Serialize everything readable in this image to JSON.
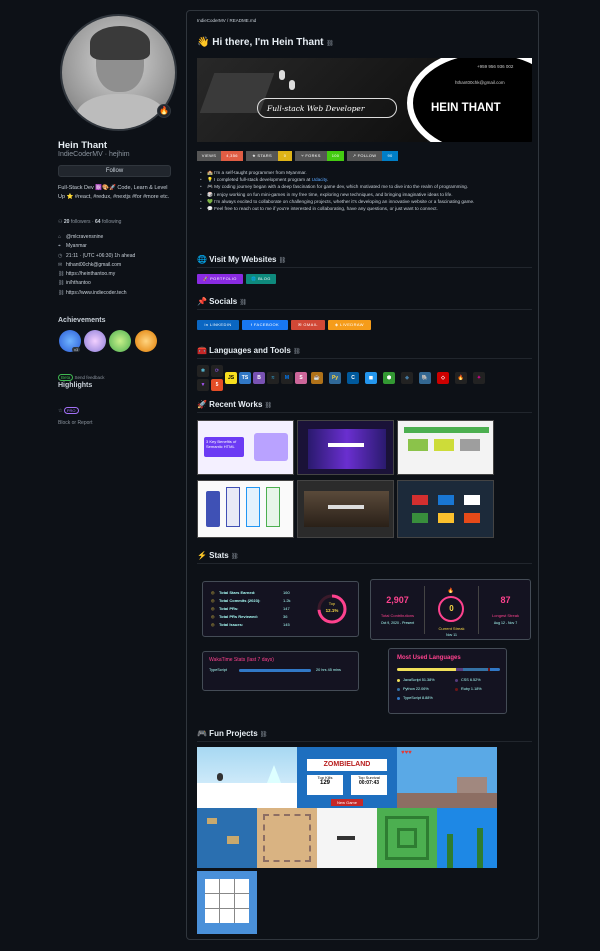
{
  "profile": {
    "name": "Hein Thant",
    "username": "IndieCoderMV · hejhim",
    "follow_label": "Follow",
    "bio": "Full-Stack Dev ⚛️🎨🚀 Code, Learn & Level Up ⭐ #react, #redux, #nextjs #for #more etc.",
    "followers_count": "20",
    "followers_label": "followers",
    "following_count": "64",
    "following_label": "following",
    "meta": [
      {
        "icon": "org-icon",
        "glyph": "⌂",
        "text": "@mlcravensnine"
      },
      {
        "icon": "location-icon",
        "glyph": "⌖",
        "text": "Myanmar"
      },
      {
        "icon": "clock-icon",
        "glyph": "◷",
        "text": "21:11 · (UTC +06:30) 1h ahead"
      },
      {
        "icon": "mail-icon",
        "glyph": "✉",
        "text": "hthant00chk@gmail.com"
      },
      {
        "icon": "link-icon",
        "glyph": "⛓",
        "text": "https://heinthantoo.my"
      },
      {
        "icon": "link-icon",
        "glyph": "⛓",
        "text": "in/hthantoo"
      },
      {
        "icon": "link-icon",
        "glyph": "⛓",
        "text": "https://www.indiecoder.tech"
      }
    ],
    "achievements_title": "Achievements",
    "achievement_x3": "x3",
    "beta_label": "Beta",
    "send_feedback": "Send feedback",
    "highlights_title": "Highlights",
    "pro_label": "PRO",
    "block_report": "Block or Report"
  },
  "readme": {
    "path": "IndieCoderMV / README.md",
    "greeting": "👋 Hi there, I'm Hein Thant",
    "banner": {
      "tagline": "Full-stack Web Developer",
      "phone": "+959 956 936 002",
      "email": "hthant00chk@gmail.com",
      "title": "HEIN THANT"
    },
    "shields": [
      {
        "label": "VIEWS",
        "value": "4,356",
        "lc": "#555",
        "vc": "#e05d44"
      },
      {
        "label": "★ STARS",
        "value": "0",
        "lc": "#555",
        "vc": "#dfb317"
      },
      {
        "label": "⑂ FORKS",
        "value": "100",
        "lc": "#555",
        "vc": "#4c1"
      },
      {
        "label": "↗ FOLLOW",
        "value": "90",
        "lc": "#555",
        "vc": "#007ec6"
      }
    ],
    "intro": [
      "🏫 I'm a self-taught programmer from Myanmar.",
      "💡 I completed full-stack development program at Udacity.",
      "🎮 My coding journey began with a deep fascination for game dev, which motivated me to dive into the realm of programming.",
      "🎲 I enjoy working on fun mini-games in my free time, exploring new techniques, and bringing imaginative ideas to life.",
      "💚 I'm always excited to collaborate on challenging projects, whether it's developing an innovative website or a fascinating game.",
      "💬 Feel free to reach out to me if you're interested in collaborating, have any questions, or just want to connect."
    ],
    "intro_link": "Udacity",
    "websites_title": "🌐 Visit My Websites",
    "websites": [
      {
        "label": "🚀 PORTFOLIO",
        "color": "#8a2be2"
      },
      {
        "label": "🌐 BLOG",
        "color": "#0e8a7d"
      }
    ],
    "socials_title": "📌 Socials",
    "socials": [
      {
        "label": "in LINKEDIN",
        "color": "#0a66c2"
      },
      {
        "label": "f FACEBOOK",
        "color": "#1877f2"
      },
      {
        "label": "✉ GMAIL",
        "color": "#d14836"
      },
      {
        "label": "◈ LIVEDRAW",
        "color": "#f59c1a"
      }
    ],
    "tools_title": "🧰 Languages and Tools",
    "tools": [
      {
        "name": "react",
        "glyph": "⚛",
        "bg": "#222",
        "fg": "#61dafb"
      },
      {
        "name": "redux",
        "glyph": "⟳",
        "bg": "#222",
        "fg": "#764abc"
      },
      {
        "name": "vite",
        "glyph": "▼",
        "bg": "#222",
        "fg": "#a855f7"
      },
      {
        "name": "html",
        "glyph": "5",
        "bg": "#e44d26",
        "fg": "#fff"
      },
      {
        "name": "js",
        "glyph": "JS",
        "bg": "#f7df1e",
        "fg": "#000"
      },
      {
        "name": "ts",
        "glyph": "TS",
        "bg": "#3178c6",
        "fg": "#fff"
      },
      {
        "name": "bootstrap",
        "glyph": "B",
        "bg": "#7952b3",
        "fg": "#fff"
      },
      {
        "name": "tailwind",
        "glyph": "≈",
        "bg": "#222",
        "fg": "#38bdf8"
      },
      {
        "name": "mui",
        "glyph": "M",
        "bg": "#222",
        "fg": "#007fff"
      },
      {
        "name": "sass",
        "glyph": "S",
        "bg": "#cc6699",
        "fg": "#fff"
      },
      {
        "name": "java",
        "glyph": "☕",
        "bg": "#b07219",
        "fg": "#fff"
      },
      {
        "name": "python",
        "glyph": "Py",
        "bg": "#306998",
        "fg": "#ffd43b"
      },
      {
        "name": "c",
        "glyph": "C",
        "bg": "#00599c",
        "fg": "#fff"
      },
      {
        "name": "docker",
        "glyph": "◼",
        "bg": "#2496ed",
        "fg": "#fff"
      },
      {
        "name": "node",
        "glyph": "⬢",
        "bg": "#339933",
        "fg": "#fff"
      },
      {
        "name": "mysql",
        "glyph": "◆",
        "bg": "#222",
        "fg": "#4479a1"
      },
      {
        "name": "postgres",
        "glyph": "🐘",
        "bg": "#336791",
        "fg": "#fff"
      },
      {
        "name": "rails",
        "glyph": "◇",
        "bg": "#cc0000",
        "fg": "#fff"
      },
      {
        "name": "firebase",
        "glyph": "🔥",
        "bg": "#222",
        "fg": "#ffca28"
      },
      {
        "name": "graphql",
        "glyph": "✦",
        "bg": "#222",
        "fg": "#e10098"
      }
    ],
    "works_title": "🚀 Recent Works",
    "works_caption": "3 Key Benefits of Semantic HTML",
    "stats_title": "⚡ Stats",
    "github_stats": [
      {
        "label": "Total Stars Earned:",
        "value": "160"
      },
      {
        "label": "Total Commits (2023):",
        "value": "1.2k"
      },
      {
        "label": "Total PRs:",
        "value": "147"
      },
      {
        "label": "Total PRs Reviewed:",
        "value": "36"
      },
      {
        "label": "Total Issues:",
        "value": "145"
      }
    ],
    "rank_label": "Top",
    "rank_value": "12.1%",
    "streak": {
      "total": "2,907",
      "total_label": "Total Contributions",
      "total_range": "Oct 9, 2020 - Present",
      "current": "0",
      "current_label": "Current Streak",
      "current_range": "Nov 11",
      "longest": "87",
      "longest_label": "Longest Streak",
      "longest_range": "Aug 12 - Nov 7"
    },
    "wakatime_title": "WakaTime Stats (last 7 days)",
    "wakatime_lang": "TypeScript",
    "wakatime_time": "20 hrs 45 mins",
    "langs_title": "Most Used Languages",
    "langs": [
      {
        "name": "JavaScript 51.38%",
        "color": "#f1e05a"
      },
      {
        "name": "CSS 6.52%",
        "color": "#563d7c"
      },
      {
        "name": "Python 22.06%",
        "color": "#3572a5"
      },
      {
        "name": "Ruby 1.18%",
        "color": "#701516"
      },
      {
        "name": "TypeScript 8.88%",
        "color": "#3178c6"
      }
    ],
    "lang_bar_pct": [
      51.38,
      6.52,
      22.06,
      1.18,
      8.88
    ],
    "projects_title": "🎮 Fun Projects",
    "zombieland": {
      "title": "ZOMBIELAND",
      "top_kills": "Top Kills",
      "kills": "129",
      "top_survival": "Top Survival",
      "survival": "00:07:43",
      "new_game": "New Game"
    }
  }
}
